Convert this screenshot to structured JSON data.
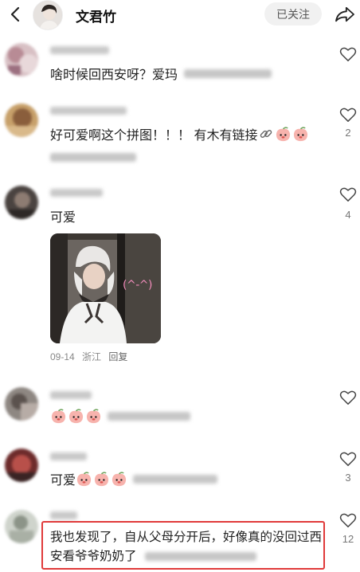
{
  "header": {
    "name": "文君竹",
    "follow_label": "已关注"
  },
  "comments": [
    {
      "text": "啥时候回西安呀？爱玛"
    },
    {
      "text": "好可爱啊这个拼图！！！ 有木有链接",
      "likes": "2"
    },
    {
      "text": "可爱",
      "likes": "4",
      "image_caption": "(^-^)",
      "date": "09-14",
      "location": "浙江",
      "reply_label": "回复"
    },
    {
      "text": ""
    },
    {
      "text": "可爱",
      "likes": "3"
    },
    {
      "text": "我也发现了，自从父母分开后，好像真的没回过西安看爷爷奶奶了",
      "likes": "12"
    }
  ],
  "colors": {
    "accent_box": "#e03a3a",
    "kaomoji": "#f08bb9"
  }
}
